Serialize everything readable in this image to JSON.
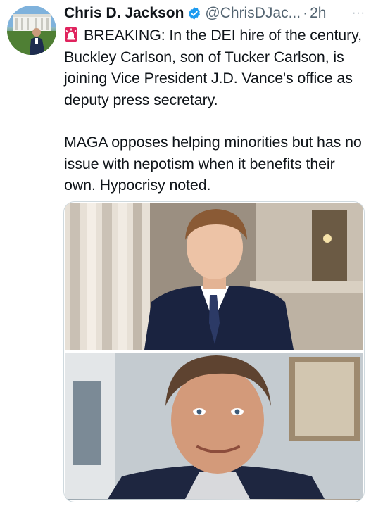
{
  "tweet": {
    "author_name": "Chris D. Jackson",
    "handle": "@ChrisDJac...",
    "separator": "·",
    "time": "2h",
    "more": "···",
    "siren_icon": "police-light-emoji",
    "text_line1": "BREAKING: In the DEI hire of the century, Buckley Carlson, son of Tucker Carlson, is joining Vice President J.D. Vance's office as deputy press secretary.",
    "text_line2": "MAGA opposes helping minorities but has no issue with nepotism when it benefits their own. Hypocrisy noted."
  },
  "colors": {
    "text": "#0f1419",
    "secondary": "#536471",
    "verified": "#1d9bf0",
    "border": "#cfd9de"
  },
  "media": {
    "images": [
      {
        "icon": "young-man-in-suit-photo"
      },
      {
        "icon": "man-smiling-portrait-photo"
      }
    ]
  }
}
